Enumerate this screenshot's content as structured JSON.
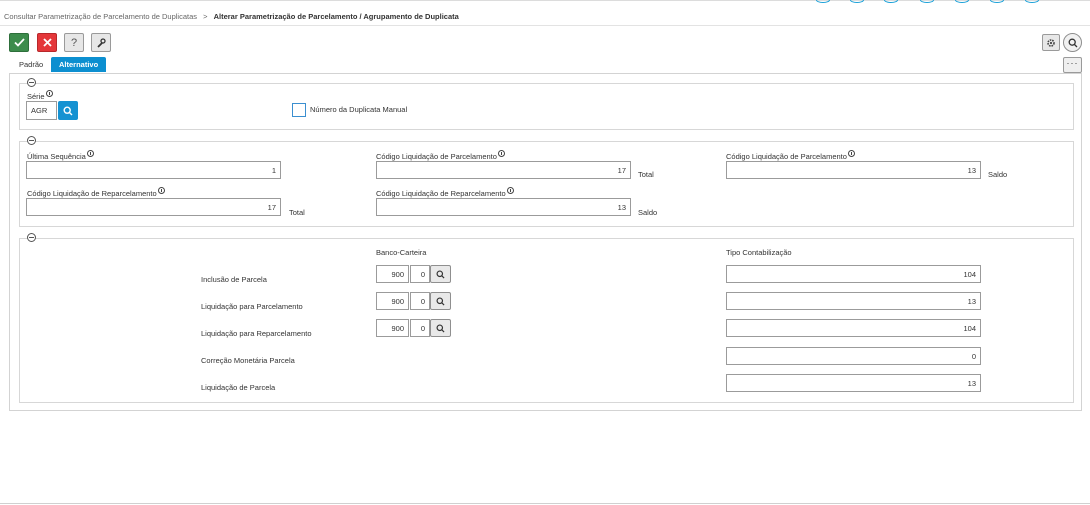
{
  "breadcrumb": {
    "parent": "Consultar Parametrização de Parcelamento de Duplicatas",
    "separator": ">",
    "current": "Alterar Parametrização de Parcelamento / Agrupamento de Duplicata"
  },
  "toolbar": {
    "help_label": "?",
    "more_label": "···"
  },
  "tabs": [
    {
      "label": "Padrão",
      "active": false
    },
    {
      "label": "Alternativo",
      "active": true
    }
  ],
  "section1": {
    "serie_label": "Série",
    "serie_value": "AGR",
    "numero_manual_label": "Número da Duplicata Manual",
    "numero_manual_checked": false
  },
  "section2": {
    "ultima_seq_label": "Última Sequência",
    "ultima_seq_value": "1",
    "cod_liq_parc_label": "Código Liquidação de Parcelamento",
    "cod_liq_parc_total_value": "17",
    "total_label": "Total",
    "cod_liq_parc_saldo_value": "13",
    "saldo_label": "Saldo",
    "cod_liq_reparc_label": "Código Liquidação de Reparcelamento",
    "cod_liq_reparc_total_value": "17",
    "cod_liq_reparc_saldo_value": "13"
  },
  "section3": {
    "banco_carteira_header": "Banco-Carteira",
    "tipo_contab_header": "Tipo Contabilização",
    "rows": [
      {
        "label": "Inclusão de Parcela",
        "banco": "900",
        "carteira": "0",
        "tipo": "104"
      },
      {
        "label": "Liquidação para Parcelamento",
        "banco": "900",
        "carteira": "0",
        "tipo": "13"
      },
      {
        "label": "Liquidação para Reparcelamento",
        "banco": "900",
        "carteira": "0",
        "tipo": "104"
      },
      {
        "label": "Correção Monetária Parcela",
        "tipo": "0"
      },
      {
        "label": "Liquidação de Parcela",
        "tipo": "13"
      }
    ]
  },
  "colors": {
    "accent": "#0c8fd0",
    "confirm": "#3d8c4c",
    "cancel": "#e4373a"
  }
}
